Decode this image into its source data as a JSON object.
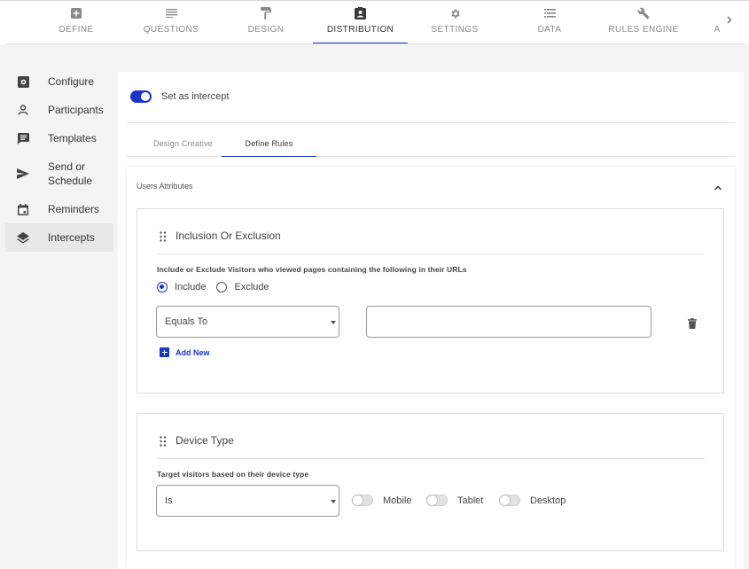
{
  "top_tabs": [
    {
      "label": "DEFINE",
      "icon": "plus-box-icon"
    },
    {
      "label": "QUESTIONS",
      "icon": "lines-icon"
    },
    {
      "label": "DESIGN",
      "icon": "paint-roller-icon"
    },
    {
      "label": "DISTRIBUTION",
      "icon": "contact-card-icon",
      "active": true
    },
    {
      "label": "SETTINGS",
      "icon": "gear-icon"
    },
    {
      "label": "DATA",
      "icon": "list-icon"
    },
    {
      "label": "RULES ENGINE",
      "icon": "wrench-icon"
    },
    {
      "label": "A",
      "icon": ""
    }
  ],
  "sidebar": {
    "items": [
      {
        "label": "Configure",
        "icon": "configure-icon"
      },
      {
        "label": "Participants",
        "icon": "person-icon"
      },
      {
        "label": "Templates",
        "icon": "chat-icon"
      },
      {
        "label": "Send or Schedule",
        "icon": "send-icon"
      },
      {
        "label": "Reminders",
        "icon": "calendar-icon"
      },
      {
        "label": "Intercepts",
        "icon": "layers-icon",
        "active": true
      }
    ]
  },
  "main": {
    "toggle_label": "Set as intercept",
    "toggle_on": true,
    "subtabs": [
      {
        "label": "Design Creative"
      },
      {
        "label": "Define Rules",
        "active": true
      }
    ],
    "panel": {
      "title": "Users Attributes",
      "inclusion": {
        "title": "Inclusion Or Exclusion",
        "description": "Include or Exclude Visitors who viewed pages containing the following in their URLs",
        "radio_include": "Include",
        "radio_exclude": "Exclude",
        "selected": "Include",
        "condition_value": "Equals To",
        "url_value": "",
        "add_new": "Add New"
      },
      "device": {
        "title": "Device Type",
        "description": "Target visitors based on their device type",
        "condition_value": "Is",
        "options": [
          "Mobile",
          "Tablet",
          "Desktop"
        ]
      }
    }
  },
  "colors": {
    "accent": "#1a35c7",
    "page_bg": "#f4f4f4"
  }
}
